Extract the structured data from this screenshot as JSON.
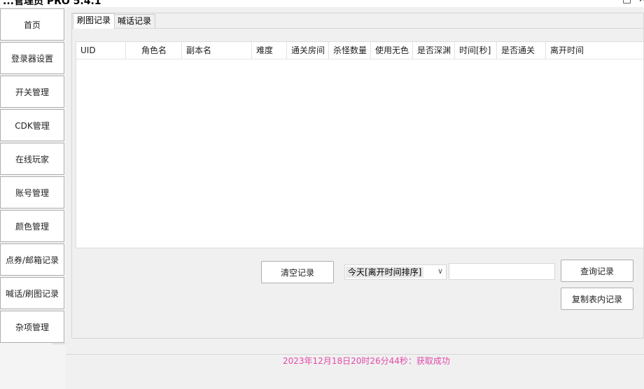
{
  "window": {
    "title": "...管理员 PRO 5.4.1",
    "minimize": "—",
    "maximize": "□",
    "close": "✕"
  },
  "sidebar": {
    "items": [
      {
        "label": "首页"
      },
      {
        "label": "登录器设置"
      },
      {
        "label": "开关管理"
      },
      {
        "label": "CDK管理"
      },
      {
        "label": "在线玩家"
      },
      {
        "label": "账号管理"
      },
      {
        "label": "颜色管理"
      },
      {
        "label": "点券/邮箱记录"
      },
      {
        "label": "喊话/刷图记录"
      },
      {
        "label": "杂项管理"
      }
    ]
  },
  "tabs": [
    {
      "label": "刷图记录",
      "active": true
    },
    {
      "label": "喊话记录",
      "active": false
    }
  ],
  "table": {
    "columns": [
      "UID",
      "角色名",
      "副本名",
      "难度",
      "通关房间",
      "杀怪数量",
      "使用无色",
      "是否深渊",
      "时间[秒]",
      "是否通关",
      "离开时间"
    ],
    "rows": []
  },
  "controls": {
    "clear_button": "清空记录",
    "filter_selected": "今天[离开时间排序]",
    "query_value": "",
    "query_button": "查询记录",
    "copy_button": "复制表内记录"
  },
  "status": {
    "message": "2023年12月18日20时26分44秒：获取成功",
    "color": "#e04aa8"
  }
}
